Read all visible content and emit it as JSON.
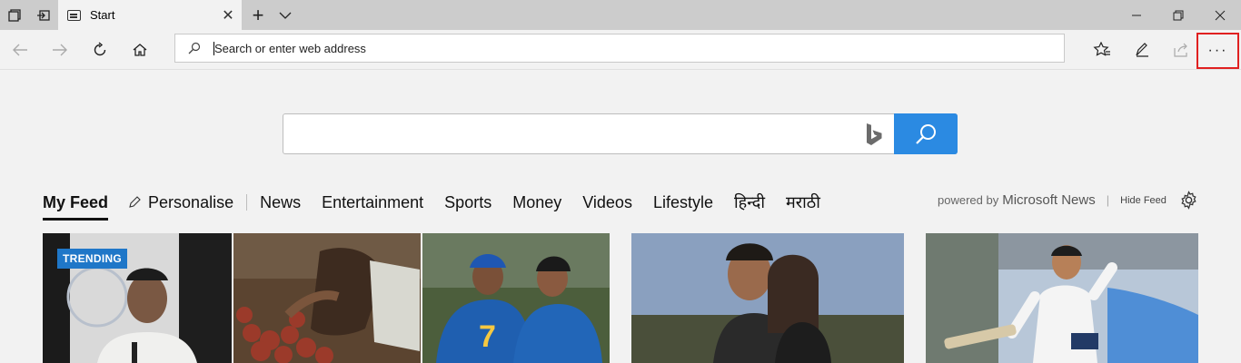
{
  "tabbar": {
    "tab_title": "Start",
    "tab_close": "✕",
    "new_tab": "+",
    "tab_list": "⌵"
  },
  "window": {
    "minimize": "—",
    "restore": "❐",
    "close": "✕"
  },
  "address": {
    "placeholder": "Search or enter web address"
  },
  "toolbar": {
    "more_label": "···"
  },
  "feed_nav": {
    "items": [
      "My Feed",
      "Personalise",
      "News",
      "Entertainment",
      "Sports",
      "Money",
      "Videos",
      "Lifestyle",
      "हिन्दी",
      "मराठी"
    ]
  },
  "powered_by": {
    "prefix": "powered by",
    "brand": "Microsoft News",
    "separator": "|",
    "hide_feed": "Hide Feed"
  },
  "cards": [
    {
      "badge": "TRENDING"
    }
  ],
  "colors": {
    "accent": "#2b8ae2",
    "highlight_box": "#e02020",
    "badge": "#1f77c8"
  }
}
